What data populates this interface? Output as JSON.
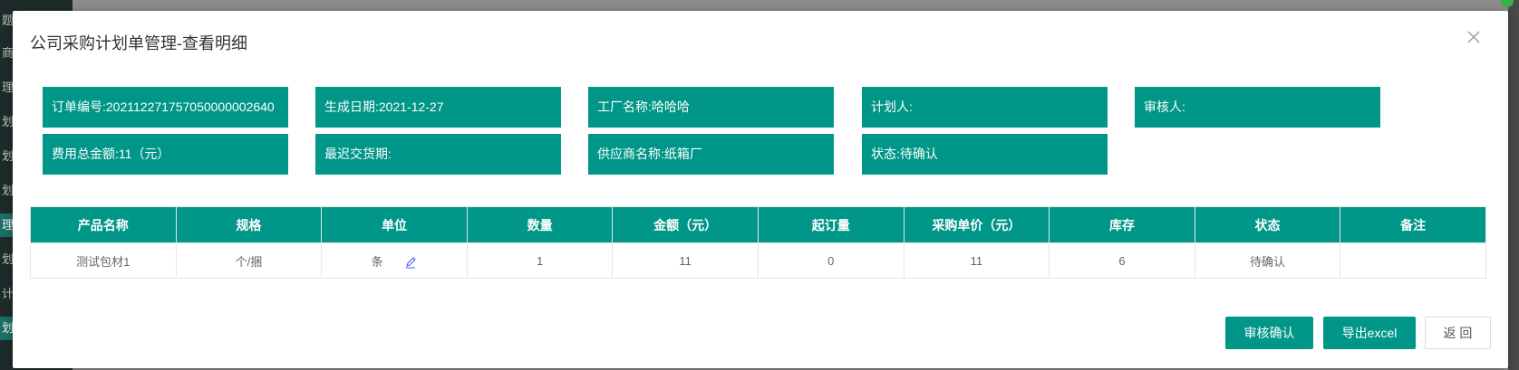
{
  "background": {
    "sidebar_fragments": [
      "题目",
      "商管",
      "理",
      "划单",
      "划审",
      "划明",
      "理",
      "划单",
      "计",
      "划单"
    ]
  },
  "modal": {
    "title": "公司采购计划单管理-查看明细",
    "close_icon": "close-icon"
  },
  "info": {
    "order_no": {
      "label": "订单编号:",
      "value": "20211227175705000000​2640"
    },
    "created_date": {
      "label": "生成日期:",
      "value": "2021-12-27"
    },
    "factory": {
      "label": "工厂名称:",
      "value": "哈哈哈"
    },
    "planner": {
      "label": "计划人:",
      "value": ""
    },
    "reviewer": {
      "label": "审核人:",
      "value": ""
    },
    "total_cost": {
      "label": "费用总金额:",
      "value": "11（元）"
    },
    "latest_delivery": {
      "label": "最迟交货期:",
      "value": ""
    },
    "supplier": {
      "label": "供应商名称:",
      "value": "纸箱厂"
    },
    "status": {
      "label": "状态:",
      "value": "待确认"
    }
  },
  "table": {
    "headers": [
      "产品名称",
      "规格",
      "单位",
      "数量",
      "金额（元）",
      "起订量",
      "采购单价（元）",
      "库存",
      "状态",
      "备注"
    ],
    "rows": [
      {
        "name": "测试包材1",
        "spec": "个/捆",
        "unit": "条",
        "qty": "1",
        "amount": "11",
        "moq": "0",
        "unit_price": "11",
        "stock": "6",
        "status": "待确认",
        "remark": ""
      }
    ]
  },
  "buttons": {
    "approve": "审核确认",
    "export": "导出excel",
    "back": "返 回"
  },
  "colors": {
    "primary": "#009688",
    "text": "#333333",
    "cell_text": "#666666"
  }
}
